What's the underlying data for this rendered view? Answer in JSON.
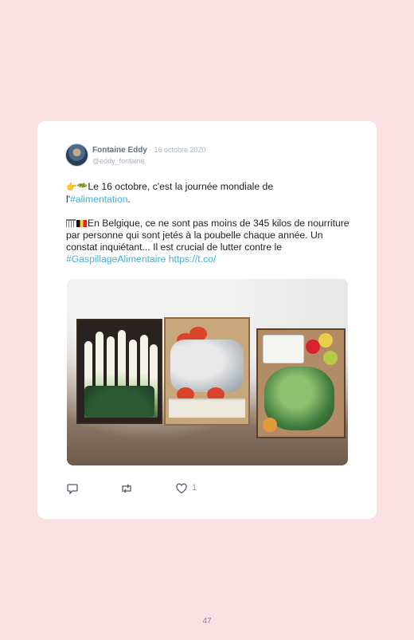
{
  "tweet": {
    "author_name": "Fontaine Eddy",
    "separator": "·",
    "date": "16 octobre 2020",
    "handle": "@eddy_fontaine",
    "line1_prefix": "Le 16 octobre, c'est la journée mondiale de",
    "line1_l": "l'",
    "hashtag_alimentation": "#alimentation",
    "line1_end": ".",
    "para2": "En Belgique, ce ne sont pas moins de 345 kilos de nourriture par personne qui sont jetés à la poubelle chaque année. Un constat inquiétant... Il est crucial de lutter contre le ",
    "hashtag_gaspillage": "#GaspillageAlimentaire",
    "link": "https://t.co/",
    "like_count": "1",
    "icons": [
      "reply-icon",
      "retweet-icon",
      "heart-icon"
    ]
  },
  "page": {
    "number": "47",
    "background": "#fbe1e4",
    "link_color": "#41b0e0"
  }
}
